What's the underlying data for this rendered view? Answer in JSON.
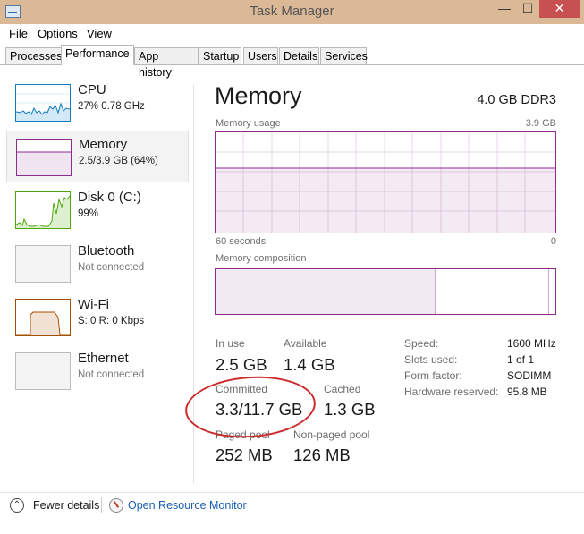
{
  "window": {
    "title": "Task Manager",
    "min": "—",
    "max": "☐",
    "close": "✕"
  },
  "menu": [
    "File",
    "Options",
    "View"
  ],
  "tabs": [
    "Processes",
    "Performance",
    "App history",
    "Startup",
    "Users",
    "Details",
    "Services"
  ],
  "active_tab": "Performance",
  "sidebar": {
    "items": [
      {
        "name": "CPU",
        "sub": "27%  0.78 GHz"
      },
      {
        "name": "Memory",
        "sub": "2.5/3.9 GB (64%)"
      },
      {
        "name": "Disk 0 (C:)",
        "sub": "99%"
      },
      {
        "name": "Bluetooth",
        "sub": "Not connected"
      },
      {
        "name": "Wi-Fi",
        "sub": "S: 0  R: 0 Kbps"
      },
      {
        "name": "Ethernet",
        "sub": "Not connected"
      }
    ]
  },
  "main": {
    "title": "Memory",
    "spec": "4.0 GB DDR3",
    "usage_label": "Memory usage",
    "usage_max": "3.9 GB",
    "time_left": "60 seconds",
    "time_right": "0",
    "composition_label": "Memory composition",
    "usage_fraction": 0.64,
    "stats": {
      "in_use_label": "In use",
      "in_use": "2.5 GB",
      "available_label": "Available",
      "available": "1.4 GB",
      "committed_label": "Committed",
      "committed": "3.3/11.7 GB",
      "cached_label": "Cached",
      "cached": "1.3 GB",
      "paged_label": "Paged pool",
      "paged": "252 MB",
      "nonpaged_label": "Non-paged pool",
      "nonpaged": "126 MB"
    },
    "details": [
      {
        "label": "Speed:",
        "value": "1600 MHz"
      },
      {
        "label": "Slots used:",
        "value": "1 of 1"
      },
      {
        "label": "Form factor:",
        "value": "SODIMM"
      },
      {
        "label": "Hardware reserved:",
        "value": "95.8 MB"
      }
    ]
  },
  "footer": {
    "fewer_details": "Fewer details",
    "resource_monitor": "Open Resource Monitor"
  },
  "colors": {
    "memory": "#8b2d8b",
    "cpu": "#117dbb",
    "disk": "#4da60c",
    "wifi": "#a74f01",
    "annotation": "#cc2a2a"
  }
}
